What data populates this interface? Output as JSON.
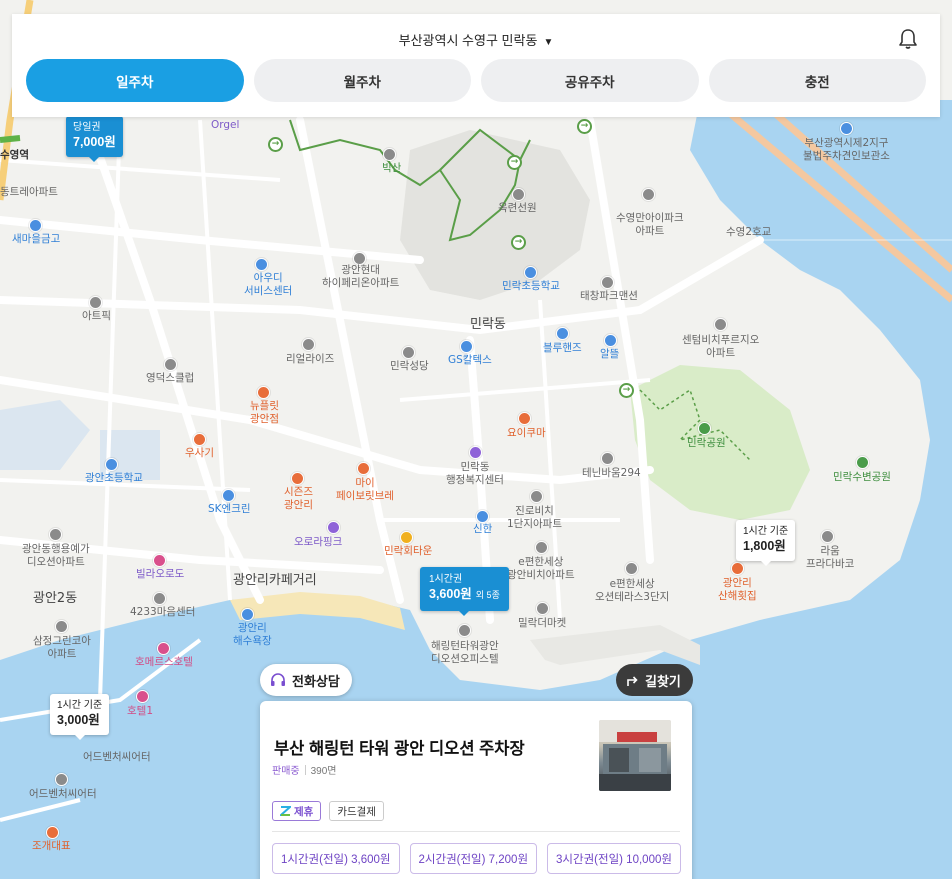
{
  "header": {
    "location": "부산광역시 수영구 민락동",
    "tabs": [
      {
        "label": "일주차",
        "active": true
      },
      {
        "label": "월주차",
        "active": false
      },
      {
        "label": "공유주차",
        "active": false
      },
      {
        "label": "충전",
        "active": false
      }
    ]
  },
  "map": {
    "area_labels": {
      "minrak": "민락동",
      "gwangan2": "광안2동",
      "cafe_street": "광안리카페거리"
    },
    "place_labels": {
      "l_trail": "빅산",
      "l_orangseonwon": "옥련선원",
      "l_suyeong_apt": "수영만아이파크\n아파트",
      "l_suyeong2": "수영2호교",
      "l_busan_court": "부산광역시제2지구\n불법주차견인보관소",
      "l_gwangan_apt": "광안현대\n하이페리온아파트",
      "l_aud": "아우디\n서비스센터",
      "l_minrak_school": "민락초등학교",
      "l_dongchang": "태창파크맨션",
      "l_art": "아트픽",
      "l_gwangmun": "리얼라이즈",
      "l_minrak_church": "민락성당",
      "l_gs": "GS칼텍스",
      "l_blue": "블루핸즈",
      "l_alm": "알뜰",
      "l_centum": "센텀비치푸르지오\n아파트",
      "l_minrak_park": "민락공원",
      "l_yeongdo": "영덕스클럽",
      "l_tuple": "뉴플릿\n광안점",
      "l_usagi": "우사기",
      "l_yoikuma": "요이쿠마",
      "l_gwangan_school": "광안초등학교",
      "l_minrak_center": "민락동\n행정복지센터",
      "l_tenibat": "테닌바움294",
      "l_minrak_river": "민락수변공원",
      "l_mypaper": "마이\n페이보릿브레",
      "l_sizen": "시즌즈\n광안리",
      "l_sk": "SK엔크린",
      "l_jinro": "진로비치\n1단지아파트",
      "l_shinhan": "신한",
      "l_orapink": "오로라핑크",
      "l_minrak_town": "민락회타운",
      "l_ecobuild": "e편한세상\n광안비치아파트",
      "l_ecoterrace": "e편한세상\n오션테라스3단지",
      "l_laou": "라움\n프라다바코",
      "l_gwangan_raw": "광안리\n산해횟집",
      "l_gwangan_yoga": "광안동행용예가\n디오션아파트",
      "l_villa": "빌라오로도",
      "l_4233": "4233마음센터",
      "l_sam": "삼정그린코아\n아파트",
      "l_hoemers": "호메르스호텔",
      "l_beach": "광안리\n해수욕장",
      "l_mildamarket": "밀락더마켓",
      "l_hailing": "해링턴타워광안\n디오션오피스텔",
      "l_hotel1": "호텔1",
      "l_adventure1": "어드벤처씨어터",
      "l_adventure2": "어드벤처씨어터",
      "l_jogae": "조개대표",
      "l_orgel": "Orgel",
      "l_semaeul": "새마을금고",
      "l_suyeong": "수영역",
      "l_trail_apt": "동트레아파트"
    },
    "parking_markers": [
      {
        "type": "당일권",
        "price": "7,000원",
        "style": "blue"
      },
      {
        "type": "1시간 기준",
        "price": "1,800원",
        "style": "white"
      },
      {
        "type": "1시간 기준",
        "price": "3,000원",
        "style": "white"
      },
      {
        "type": "1시간권",
        "price": "3,600원",
        "extra": "외 5종",
        "style": "blue"
      }
    ]
  },
  "card": {
    "consult_label": "전화상담",
    "directions_label": "길찾기",
    "name": "부산 해링턴 타워 광안 디오션 주차장",
    "status": "판매중",
    "spaces": "390면",
    "badges": {
      "partner": "제휴",
      "card_pay": "카드결제"
    },
    "tickets": [
      "1시간권(전일) 3,600원",
      "2시간권(전일) 7,200원",
      "3시간권(전일) 10,000원"
    ]
  },
  "colors": {
    "accent": "#1a9fe3",
    "sea": "#a9d4f1",
    "purple": "#7a4fd0"
  }
}
